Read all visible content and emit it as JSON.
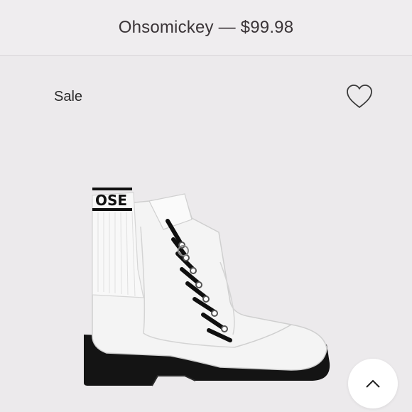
{
  "header": {
    "title": "Ohsomickey — $99.98"
  },
  "listing": {
    "sale_label": "Sale"
  },
  "product": {
    "boot_collar_text": "OSE"
  },
  "icons": {
    "favorite": "heart-outline-icon",
    "scroll_top": "chevron-up-icon"
  },
  "colors": {
    "background": "#eceaec",
    "header_text": "#3a3437",
    "boot_white": "#f5f5f5",
    "laces_sole": "#111111"
  }
}
